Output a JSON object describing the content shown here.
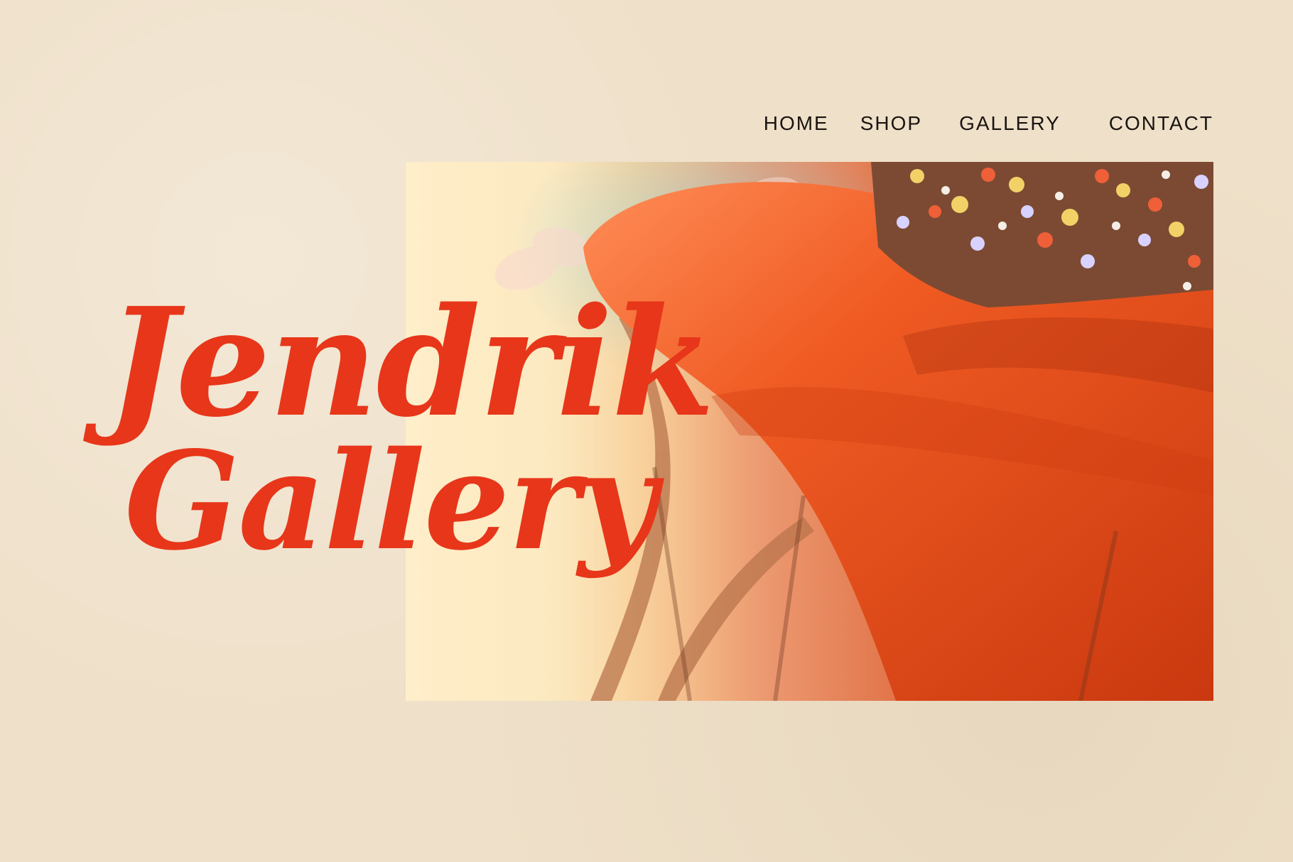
{
  "nav": {
    "items": [
      "HOME",
      "SHOP",
      "GALLERY",
      "CONTACT"
    ]
  },
  "hero": {
    "title_line1": "Jendrik",
    "title_line2": "Gallery"
  },
  "colors": {
    "background": "#efe0c9",
    "accent": "#e7361a",
    "nav_text": "#1a1410"
  }
}
